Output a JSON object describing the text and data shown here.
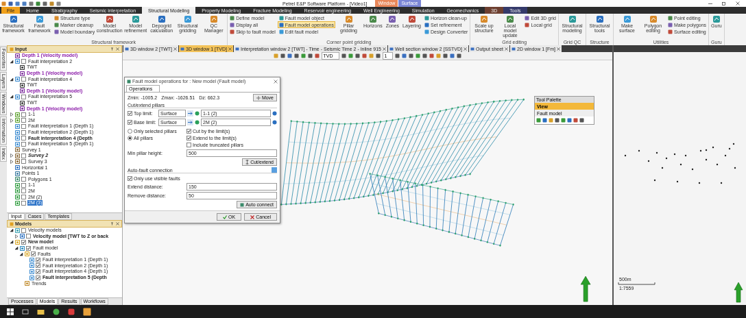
{
  "title_bar": {
    "title": "Petrel E&P Software Platform - [Video1]",
    "context_tabs": [
      {
        "label": "Window",
        "color": "#e8875a"
      },
      {
        "label": "Surface",
        "color": "#7b86d6"
      }
    ]
  },
  "ribbon": {
    "tabs": [
      {
        "label": "File",
        "kind": "file",
        "selected": false
      },
      {
        "label": "Home",
        "kind": "tab",
        "selected": false
      },
      {
        "label": "Stratigraphy",
        "kind": "tab",
        "selected": false
      },
      {
        "label": "Seismic interpretation",
        "kind": "tab",
        "selected": false
      },
      {
        "label": "Structural Modeling",
        "kind": "tab",
        "selected": true
      },
      {
        "label": "Property Modeling",
        "kind": "tab",
        "selected": false
      },
      {
        "label": "Fracture Modeling",
        "kind": "tab",
        "selected": false
      },
      {
        "label": "Reservoir engineering",
        "kind": "tab",
        "selected": false
      },
      {
        "label": "Well Engineering",
        "kind": "tab",
        "selected": false
      },
      {
        "label": "Simulation",
        "kind": "tab",
        "selected": false
      },
      {
        "label": "Geomechanics",
        "kind": "tab",
        "selected": false
      },
      {
        "label": "3D",
        "kind": "context",
        "color": "#6e4030",
        "selected": false
      },
      {
        "label": "Tools",
        "kind": "context",
        "color": "#353a6a",
        "selected": false
      }
    ],
    "groups": [
      {
        "name": "Structural framework",
        "items": [
          {
            "label": "Structural framework",
            "kind": "large",
            "active": false
          },
          {
            "label": "Fault framework",
            "kind": "large",
            "active": false
          },
          {
            "label": "Structure type",
            "kind": "small",
            "active": false
          },
          {
            "label": "Marker cleanup",
            "kind": "small",
            "active": false
          },
          {
            "label": "Model boundary",
            "kind": "small",
            "active": false
          },
          {
            "label": "Model construction",
            "kind": "large",
            "active": false
          },
          {
            "label": "Model refinement",
            "kind": "large",
            "active": false
          },
          {
            "label": "Depogrid calculation",
            "kind": "large",
            "active": false
          },
          {
            "label": "Structural gridding",
            "kind": "large",
            "active": false
          },
          {
            "label": "QC Manager",
            "kind": "large",
            "active": false
          }
        ]
      },
      {
        "name": "Corner point gridding",
        "items": [
          {
            "label": "Define model",
            "kind": "small",
            "active": false
          },
          {
            "label": "Display all",
            "kind": "small",
            "active": false
          },
          {
            "label": "Skip to fault model",
            "kind": "small",
            "active": false
          },
          {
            "label": "Fault model object",
            "kind": "small",
            "active": false
          },
          {
            "label": "Fault model operations",
            "kind": "small",
            "active": true
          },
          {
            "label": "Edit fault model",
            "kind": "small",
            "active": false
          },
          {
            "label": "Pillar gridding",
            "kind": "large",
            "active": false
          },
          {
            "label": "Horizons",
            "kind": "large",
            "active": false
          },
          {
            "label": "Zones",
            "kind": "large",
            "active": false
          },
          {
            "label": "Layering",
            "kind": "large",
            "active": false
          },
          {
            "label": "Horizon clean-up",
            "kind": "small",
            "active": false
          },
          {
            "label": "Set refinement",
            "kind": "small",
            "active": false
          },
          {
            "label": "Design Converter",
            "kind": "small",
            "active": false
          }
        ]
      },
      {
        "name": "Grid editing",
        "items": [
          {
            "label": "Scale up structure",
            "kind": "large",
            "active": false
          },
          {
            "label": "Local model update",
            "kind": "large",
            "active": false
          },
          {
            "label": "Edit 3D grid",
            "kind": "small",
            "active": false
          },
          {
            "label": "Local grid",
            "kind": "small",
            "active": false
          }
        ]
      },
      {
        "name": "Grid QC",
        "items": [
          {
            "label": "Structural modeling",
            "kind": "large",
            "active": false
          }
        ]
      },
      {
        "name": "Structure",
        "items": [
          {
            "label": "Structural tools",
            "kind": "large",
            "active": false
          }
        ]
      },
      {
        "name": "Utilities",
        "items": [
          {
            "label": "Make surface",
            "kind": "large",
            "active": false
          },
          {
            "label": "Polygon editing",
            "kind": "large",
            "active": false
          },
          {
            "label": "Point editing",
            "kind": "small",
            "active": false
          },
          {
            "label": "Make polygons",
            "kind": "small",
            "active": false
          },
          {
            "label": "Surface editing",
            "kind": "small",
            "active": false
          }
        ]
      },
      {
        "name": "Guru",
        "items": [
          {
            "label": "Guru",
            "kind": "large",
            "active": false
          }
        ]
      }
    ]
  },
  "side_tabs": [
    "Favorites",
    "Layers",
    "Windows",
    "Information",
    "Index"
  ],
  "input_panel": {
    "title": "Input",
    "items": [
      {
        "label": "Depth 1 (Velocity model)",
        "kind": "depth",
        "bold": true,
        "color": "#8a1aa8",
        "selected": false
      },
      {
        "label": "Fault interpretation 2",
        "kind": "fault",
        "checked": false,
        "expanded": true,
        "selected": false,
        "children": [
          {
            "label": "TWT",
            "kind": "time",
            "selected": false
          },
          {
            "label": "Depth 1 (Velocity model)",
            "kind": "depth",
            "bold": true,
            "color": "#8a1aa8",
            "selected": false
          }
        ]
      },
      {
        "label": "Fault interpretation 4",
        "kind": "fault",
        "checked": false,
        "expanded": true,
        "selected": false,
        "children": [
          {
            "label": "TWT",
            "kind": "time",
            "selected": false
          },
          {
            "label": "Depth 1 (Velocity model)",
            "kind": "depth",
            "bold": true,
            "color": "#8a1aa8",
            "selected": false
          }
        ]
      },
      {
        "label": "Fault interpretation 5",
        "kind": "fault",
        "checked": false,
        "expanded": true,
        "selected": false,
        "children": [
          {
            "label": "TWT",
            "kind": "time",
            "selected": false
          },
          {
            "label": "Depth 1 (Velocity model)",
            "kind": "depth",
            "bold": true,
            "color": "#8a1aa8",
            "selected": false
          }
        ]
      },
      {
        "label": "1-1",
        "kind": "surface",
        "checked": false,
        "expanded": false,
        "selected": false
      },
      {
        "label": "2M",
        "kind": "surface",
        "checked": false,
        "expanded": false,
        "selected": false
      },
      {
        "label": "Fault interpretation 1 (Depth 1)",
        "kind": "fault",
        "checked": false,
        "selected": false
      },
      {
        "label": "Fault interpretation 2 (Depth 1)",
        "kind": "fault",
        "checked": false,
        "selected": false
      },
      {
        "label": "Fault interpretation 4 (Depth",
        "kind": "fault",
        "checked": false,
        "bold": true,
        "selected": false
      },
      {
        "label": "Fault interpretation 5 (Depth 1)",
        "kind": "fault",
        "checked": false,
        "selected": false
      },
      {
        "label": "Survey 1",
        "kind": "survey",
        "selected": false
      },
      {
        "label": "Survey 2",
        "kind": "survey",
        "checked": false,
        "expanded": false,
        "bold": true,
        "italic": true,
        "selected": false
      },
      {
        "label": "Survey 3",
        "kind": "survey",
        "checked": false,
        "expanded": false,
        "selected": false
      },
      {
        "label": "Horizontal 1",
        "kind": "wells",
        "selected": false
      },
      {
        "label": "Points 1",
        "kind": "points",
        "selected": false
      },
      {
        "label": "Polygons 1",
        "kind": "polygons",
        "checked": false,
        "selected": false
      },
      {
        "label": "1-1",
        "kind": "grid-surface",
        "checked": false,
        "selected": false
      },
      {
        "label": "2M",
        "kind": "grid-surface",
        "checked": false,
        "selected": false
      },
      {
        "label": "2M (2)",
        "kind": "grid-surface",
        "checked": false,
        "selected": false
      },
      {
        "label": "2M (3)",
        "kind": "grid-surface",
        "checked": false,
        "selected": true
      }
    ],
    "tabs": [
      {
        "label": "Input",
        "selected": true
      },
      {
        "label": "Cases",
        "selected": false
      },
      {
        "label": "Templates",
        "selected": false
      }
    ]
  },
  "models_panel": {
    "title": "Models",
    "items": [
      {
        "label": "Velocity models",
        "kind": "folder",
        "checked": false,
        "expanded": true,
        "selected": false,
        "children": [
          {
            "label": "Velocity model [TWT to Z or back",
            "kind": "velocity-model",
            "checked": false,
            "expanded": false,
            "bold": true,
            "selected": false
          }
        ]
      },
      {
        "label": "New model",
        "kind": "model",
        "checked": true,
        "expanded": true,
        "bold": true,
        "selected": false,
        "children": [
          {
            "label": "Fault model",
            "kind": "fault-model",
            "checked": true,
            "expanded": true,
            "selected": false,
            "children": [
              {
                "label": "Faults",
                "kind": "faults",
                "checked": true,
                "expanded": true,
                "selected": false,
                "children": [
                  {
                    "label": "Fault interpretation 1 (Depth 1)",
                    "kind": "fault",
                    "checked": true,
                    "selected": false
                  },
                  {
                    "label": "Fault interpretation 2 (Depth 1)",
                    "kind": "fault",
                    "checked": true,
                    "selected": false
                  },
                  {
                    "label": "Fault interpretation 4 (Depth 1)",
                    "kind": "fault",
                    "checked": true,
                    "selected": false
                  },
                  {
                    "label": "Fault interpretation 5 (Depth",
                    "kind": "fault",
                    "checked": true,
                    "bold": true,
                    "selected": false
                  }
                ]
              },
              {
                "label": "Trends",
                "kind": "trend",
                "selected": false
              }
            ]
          }
        ]
      }
    ],
    "tabs": [
      {
        "label": "Processes",
        "selected": false
      },
      {
        "label": "Models",
        "selected": true
      },
      {
        "label": "Results",
        "selected": false
      },
      {
        "label": "Workflows",
        "selected": false
      }
    ]
  },
  "view_tabs": [
    {
      "label": "3D window 2 [TWT]",
      "selected": false
    },
    {
      "label": "3D window 1 [TVD]",
      "selected": true
    },
    {
      "label": "Interpretation window 2 [TWT] - Time - Seismic Time 2 - Inline 915",
      "selected": false
    },
    {
      "label": "Well section window 2 [SSTVD]",
      "selected": false
    },
    {
      "label": "Output sheet",
      "selected": false
    },
    {
      "label": "2D window 1 [Fm]",
      "selected": false
    }
  ],
  "view_toolbar": {
    "domain": "TVD",
    "value": "1"
  },
  "dialog": {
    "title": "Fault model operations for : New model (Fault model)",
    "tabs": [
      {
        "label": "Operations",
        "selected": true
      }
    ],
    "stats": [
      "Zmin: -1005.2",
      "Zmax: -1626.51",
      "Dz: 662.3"
    ],
    "move_button": "Move",
    "cut": {
      "title": "Cut/extend pillars",
      "limits": [
        {
          "label": "Top limit:",
          "checked": true,
          "type": "Surface",
          "value": "1-1 (2)"
        },
        {
          "label": "Base limit:",
          "checked": true,
          "type": "Surface",
          "value": "2M (2)"
        }
      ],
      "scope": [
        {
          "label": "Only selected pillars",
          "selected": false
        },
        {
          "label": "All pillars",
          "selected": true
        }
      ],
      "options": [
        {
          "label": "Cut by the limit(s)",
          "checked": true
        },
        {
          "label": "Extend to the limit(s)",
          "checked": true
        },
        {
          "label": "Include truncated pillars",
          "checked": false
        }
      ],
      "min_height": {
        "label": "Min pillar height:",
        "value": "500"
      },
      "button": "Cut/extend"
    },
    "auto": {
      "title": "Auto-fault connection",
      "visible": {
        "label": "Only use visible faults",
        "checked": true
      },
      "fields": [
        {
          "label": "Extend distance:",
          "value": "150"
        },
        {
          "label": "Remove distance:",
          "value": "50"
        }
      ],
      "button": "Auto connect"
    },
    "buttons": [
      {
        "label": "OK",
        "kind": "ok"
      },
      {
        "label": "Cancel",
        "kind": "cancel"
      }
    ]
  },
  "tool_palette": {
    "title": "Tool Palette",
    "items": [
      {
        "label": "View",
        "selected": true
      },
      {
        "label": "Fault model",
        "selected": false
      }
    ]
  },
  "map": {
    "scale": "500m",
    "ratio": "1:7559"
  }
}
